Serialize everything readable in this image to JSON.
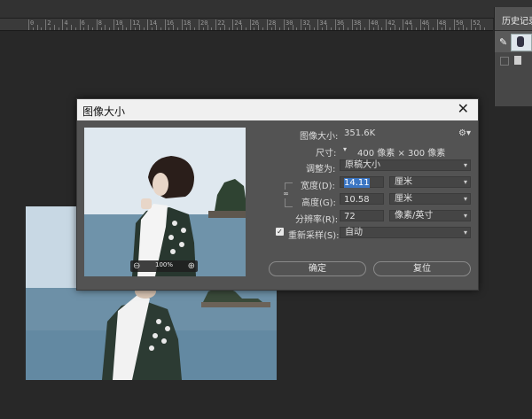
{
  "ruler": {
    "labels": [
      "0",
      "2",
      "4",
      "6",
      "8",
      "10",
      "12",
      "14",
      "16",
      "18",
      "20",
      "22",
      "24",
      "26",
      "28",
      "30",
      "32",
      "34",
      "36",
      "38",
      "40",
      "42",
      "44",
      "46",
      "48",
      "50",
      "52",
      "54"
    ]
  },
  "history_panel": {
    "tab_label": "历史记录"
  },
  "dialog": {
    "title": "图像大小",
    "image_size_label": "图像大小:",
    "image_size_value": "351.6K",
    "dimensions_label": "尺寸:",
    "dimensions_value": "400 像素 × 300 像素",
    "fit_to_label": "调整为:",
    "fit_to_value": "原稿大小",
    "width_label": "宽度(D):",
    "width_value": "14.11",
    "width_unit": "厘米",
    "height_label": "高度(G):",
    "height_value": "10.58",
    "height_unit": "厘米",
    "resolution_label": "分辨率(R):",
    "resolution_value": "72",
    "resolution_unit": "像素/英寸",
    "resample_label": "重新采样(S):",
    "resample_checked": true,
    "resample_value": "自动",
    "zoom_value": "100%",
    "ok_label": "确定",
    "reset_label": "复位"
  }
}
